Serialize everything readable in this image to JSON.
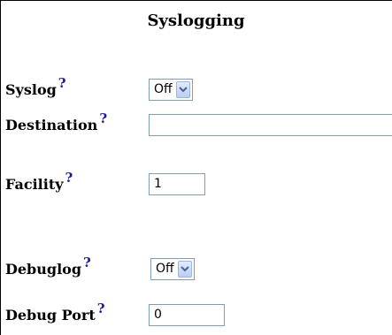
{
  "title": "Syslogging",
  "help_glyph": "?",
  "fields": {
    "syslog": {
      "label": "Syslog",
      "value": "Off"
    },
    "destination": {
      "label": "Destination",
      "value": ""
    },
    "facility": {
      "label": "Facility",
      "value": "1"
    },
    "debuglog": {
      "label": "Debuglog",
      "value": "Off"
    },
    "debug_port": {
      "label": "Debug Port",
      "value": "0"
    }
  },
  "icons": {
    "help": "question-mark-icon",
    "dropdown": "chevron-down-icon"
  },
  "colors": {
    "help": "#1a1aa0",
    "input_border": "#7f9db9"
  }
}
